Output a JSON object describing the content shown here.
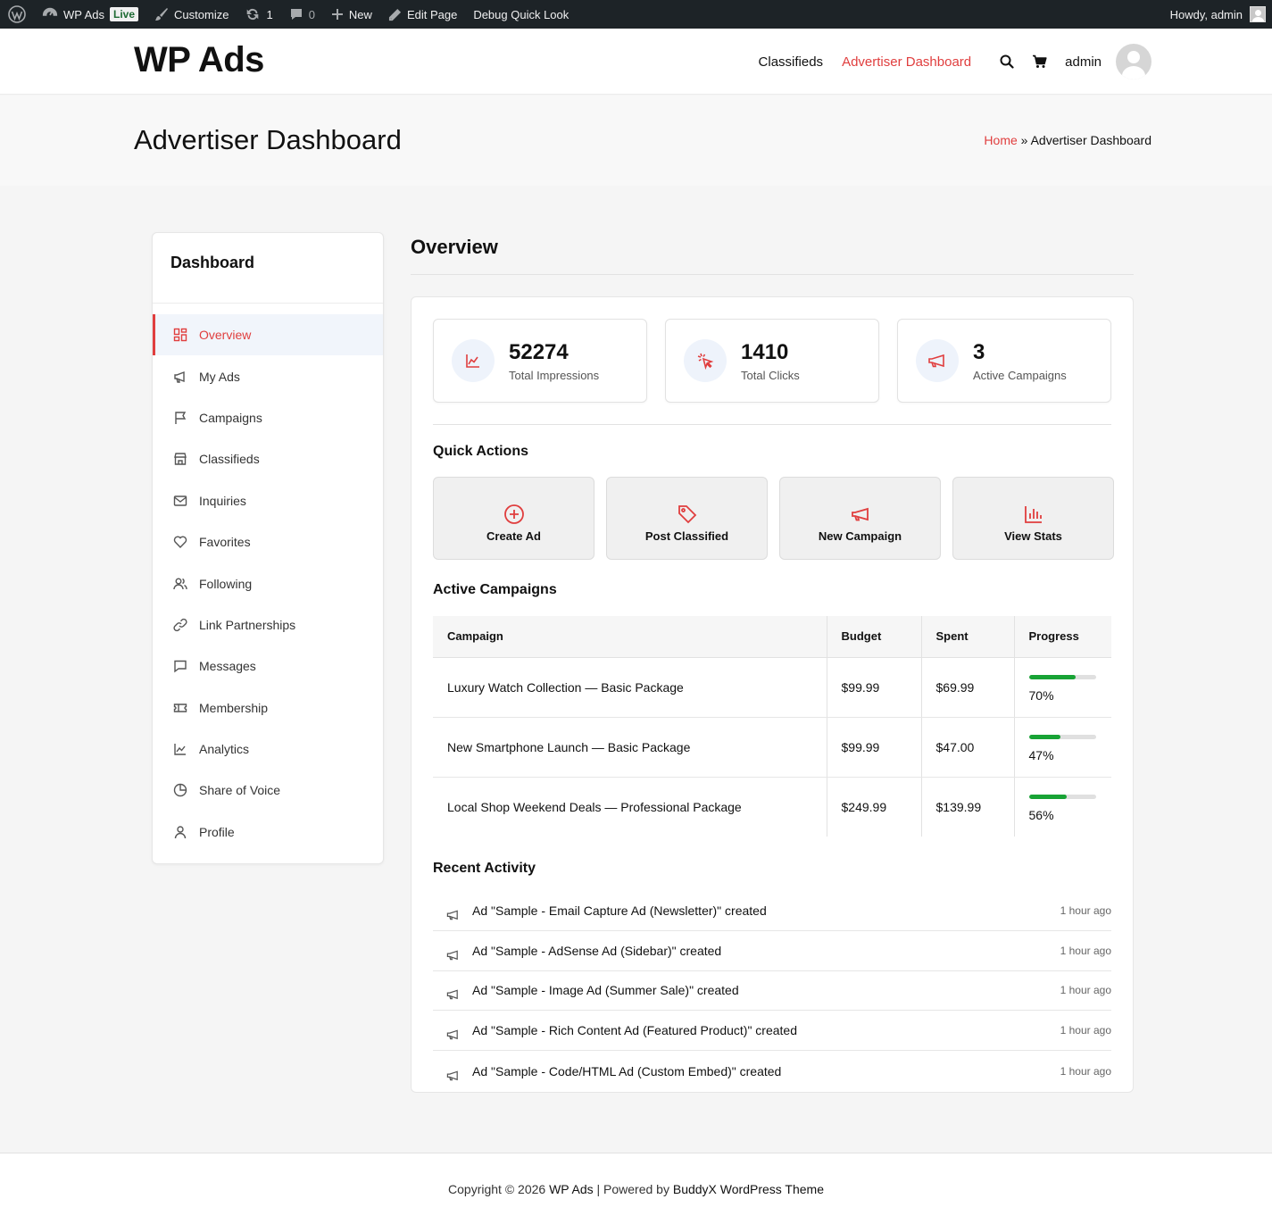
{
  "admin_bar": {
    "site_name": "WP Ads",
    "live_badge": "Live",
    "customize": "Customize",
    "updates_count": "1",
    "comments_count": "0",
    "new": "New",
    "edit_page": "Edit Page",
    "debug": "Debug Quick Look",
    "howdy": "Howdy, admin"
  },
  "header": {
    "site_title": "WP Ads",
    "nav": [
      "Classifieds",
      "Advertiser Dashboard"
    ],
    "user": "admin"
  },
  "title_bar": {
    "title": "Advertiser Dashboard",
    "breadcrumb_home": "Home",
    "breadcrumb_sep": "»",
    "breadcrumb_current": "Advertiser Dashboard"
  },
  "sidebar": {
    "heading": "Dashboard",
    "items": [
      {
        "label": "Overview",
        "icon": "grid-icon"
      },
      {
        "label": "My Ads",
        "icon": "megaphone-icon"
      },
      {
        "label": "Campaigns",
        "icon": "flag-icon"
      },
      {
        "label": "Classifieds",
        "icon": "store-icon"
      },
      {
        "label": "Inquiries",
        "icon": "mail-icon"
      },
      {
        "label": "Favorites",
        "icon": "heart-icon"
      },
      {
        "label": "Following",
        "icon": "users-icon"
      },
      {
        "label": "Link Partnerships",
        "icon": "link-icon"
      },
      {
        "label": "Messages",
        "icon": "message-icon"
      },
      {
        "label": "Membership",
        "icon": "ticket-icon"
      },
      {
        "label": "Analytics",
        "icon": "chart-icon"
      },
      {
        "label": "Share of Voice",
        "icon": "pie-icon"
      },
      {
        "label": "Profile",
        "icon": "user-icon"
      }
    ]
  },
  "overview": {
    "title": "Overview",
    "stats": [
      {
        "value": "52274",
        "label": "Total Impressions",
        "icon": "chart-line-icon"
      },
      {
        "value": "1410",
        "label": "Total Clicks",
        "icon": "cursor-click-icon"
      },
      {
        "value": "3",
        "label": "Active Campaigns",
        "icon": "megaphone-icon"
      }
    ],
    "quick_actions_title": "Quick Actions",
    "quick_actions": [
      {
        "label": "Create Ad",
        "icon": "plus-circle-icon"
      },
      {
        "label": "Post Classified",
        "icon": "tag-icon"
      },
      {
        "label": "New Campaign",
        "icon": "megaphone-icon"
      },
      {
        "label": "View Stats",
        "icon": "bar-chart-icon"
      }
    ],
    "campaigns_title": "Active Campaigns",
    "campaign_headers": [
      "Campaign",
      "Budget",
      "Spent",
      "Progress"
    ],
    "campaigns": [
      {
        "name": "Luxury Watch Collection — Basic Package",
        "budget": "$99.99",
        "spent": "$69.99",
        "progress": 70,
        "progress_text": "70%"
      },
      {
        "name": "New Smartphone Launch — Basic Package",
        "budget": "$99.99",
        "spent": "$47.00",
        "progress": 47,
        "progress_text": "47%"
      },
      {
        "name": "Local Shop Weekend Deals — Professional Package",
        "budget": "$249.99",
        "spent": "$139.99",
        "progress": 56,
        "progress_text": "56%"
      }
    ],
    "activity_title": "Recent Activity",
    "activity": [
      {
        "text": "Ad \"Sample - Email Capture Ad (Newsletter)\" created",
        "time": "1 hour ago"
      },
      {
        "text": "Ad \"Sample - AdSense Ad (Sidebar)\" created",
        "time": "1 hour ago"
      },
      {
        "text": "Ad \"Sample - Image Ad (Summer Sale)\" created",
        "time": "1 hour ago"
      },
      {
        "text": "Ad \"Sample - Rich Content Ad (Featured Product)\" created",
        "time": "1 hour ago"
      },
      {
        "text": "Ad \"Sample - Code/HTML Ad (Custom Embed)\" created",
        "time": "1 hour ago"
      }
    ]
  },
  "footer": {
    "prefix": "Copyright © 2026",
    "site": "WP Ads",
    "middle": "| Powered by",
    "theme": "BuddyX WordPress Theme"
  },
  "colors": {
    "accent": "#e03e3e",
    "progress": "#18a335",
    "admin_bar": "#1d2327"
  }
}
